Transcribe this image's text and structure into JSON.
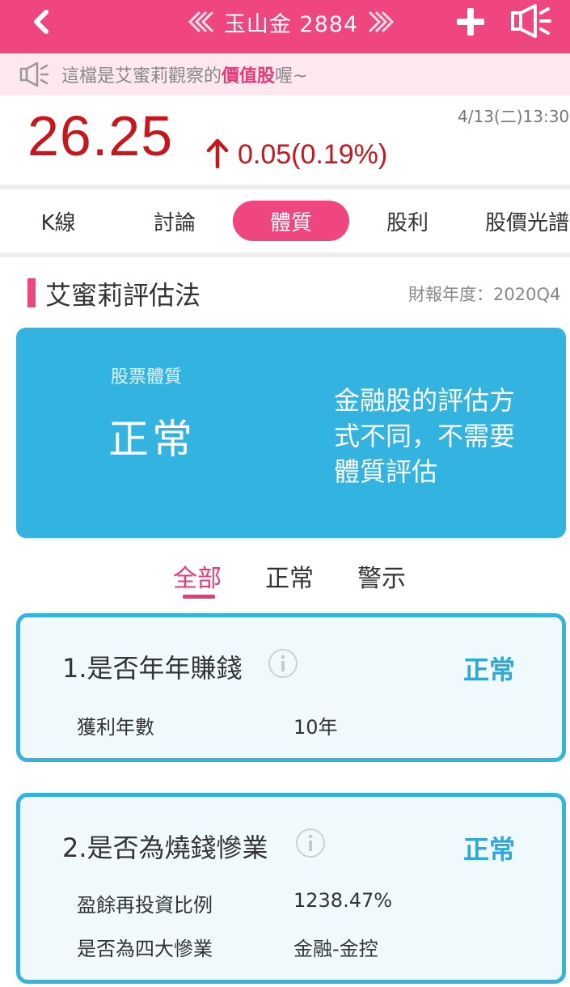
{
  "header": {
    "title": "玉山金 2884",
    "back_icon": "chevron-left-icon",
    "prev_icon": "double-chevron-left-icon",
    "next_icon": "double-chevron-right-icon",
    "add_icon": "plus-icon",
    "speaker_icon": "megaphone-icon"
  },
  "notice": {
    "prefix": "這檔是艾蜜莉觀察的",
    "highlight": "價值股",
    "suffix": "喔~"
  },
  "quote": {
    "price": "26.25",
    "change": "0.05(0.19%)",
    "datetime": "4/13(二)13:30",
    "direction": "up",
    "color": "#c8161d"
  },
  "tabs": [
    {
      "label": "K線",
      "active": false
    },
    {
      "label": "討論",
      "active": false
    },
    {
      "label": "體質",
      "active": true
    },
    {
      "label": "股利",
      "active": false
    },
    {
      "label": "股價光譜",
      "active": false
    }
  ],
  "section": {
    "title": "艾蜜莉評估法",
    "report_period": "財報年度：2020Q4"
  },
  "summary_card": {
    "label": "股票體質",
    "status": "正常",
    "description": "金融股的評估方式不同，不需要體質評估",
    "color": "#33b3e0"
  },
  "filters": [
    {
      "label": "全部",
      "active": true
    },
    {
      "label": "正常",
      "active": false
    },
    {
      "label": "警示",
      "active": false
    }
  ],
  "criteria": [
    {
      "title": "1.是否年年賺錢",
      "status": "正常",
      "rows": [
        {
          "label": "獲利年數",
          "value": "10年"
        }
      ]
    },
    {
      "title": "2.是否為燒錢慘業",
      "status": "正常",
      "rows": [
        {
          "label": "盈餘再投資比例",
          "value": "1238.47%"
        },
        {
          "label": "是否為四大慘業",
          "value": "金融-金控"
        }
      ]
    }
  ],
  "colors": {
    "brand": "#f0467f",
    "accent_blue": "#33b3e0",
    "up_red": "#c8161d"
  }
}
